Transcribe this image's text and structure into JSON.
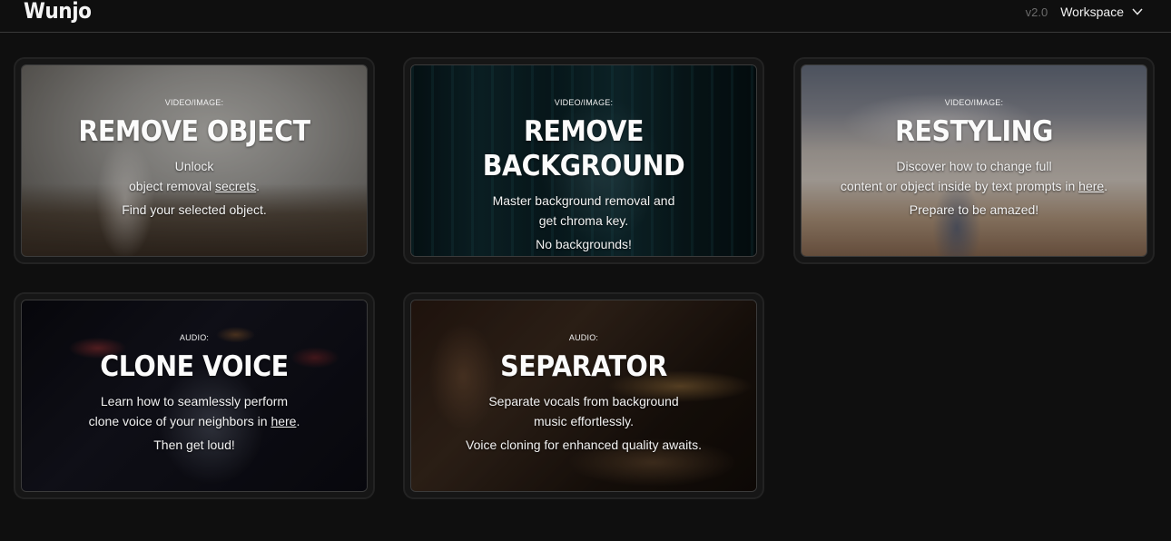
{
  "header": {
    "logo": "Wunjo",
    "version": "v2.0",
    "workspace_label": "Workspace"
  },
  "cards": [
    {
      "kicker": "VIDEO/IMAGE:",
      "title": "REMOVE OBJECT",
      "line1_pre": "Unlock",
      "line2_pre": "object removal ",
      "line2_link": "secrets",
      "line2_post": ".",
      "tagline": "Find your selected object."
    },
    {
      "kicker": "VIDEO/IMAGE:",
      "title": "REMOVE BACKGROUND",
      "line1_pre": "Master background removal and",
      "line2_pre": "get chroma key.",
      "line2_link": "",
      "line2_post": "",
      "tagline": "No backgrounds!"
    },
    {
      "kicker": "VIDEO/IMAGE:",
      "title": "RESTYLING",
      "line1_pre": "Discover how to change full",
      "line2_pre": "content or object inside by text prompts in ",
      "line2_link": "here",
      "line2_post": ".",
      "tagline": "Prepare to be amazed!"
    },
    {
      "kicker": "AUDIO:",
      "title": "CLONE VOICE",
      "line1_pre": "Learn how to seamlessly perform",
      "line2_pre": "clone voice of your neighbors in ",
      "line2_link": "here",
      "line2_post": ".",
      "tagline": "Then get loud!"
    },
    {
      "kicker": "AUDIO:",
      "title": "SEPARATOR",
      "line1_pre": "Separate vocals from background",
      "line2_pre": "music effortlessly.",
      "line2_link": "",
      "line2_post": "",
      "tagline": "Voice cloning for enhanced quality awaits."
    }
  ],
  "colors": {
    "page_bg": "#0f0f0f",
    "card_border": "#232323",
    "text": "#ffffff",
    "muted": "#6b6b6b"
  },
  "icons": {
    "workspace_dropdown": "chevron-down-icon"
  }
}
